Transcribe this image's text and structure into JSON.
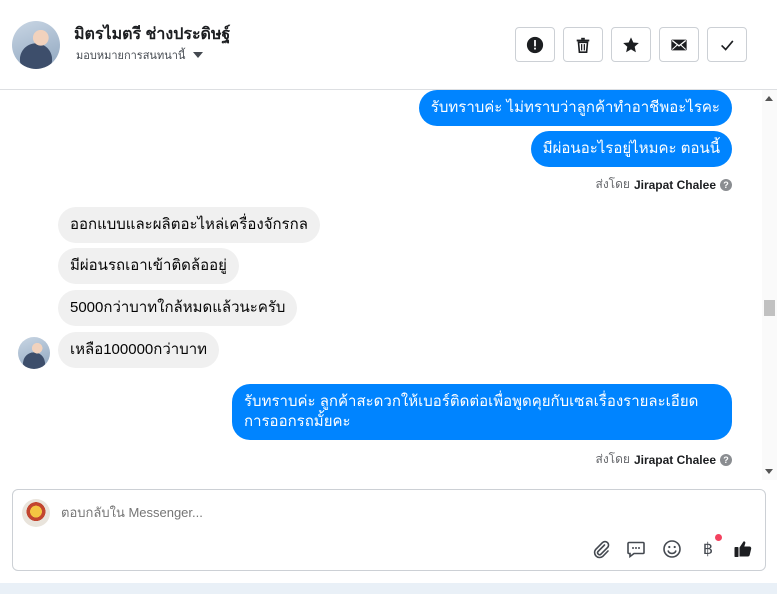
{
  "header": {
    "name": "มิตรไมตรี ช่างประดิษฐ์",
    "assign_label": "มอบหมายการสนทนานี้"
  },
  "toolbar": {
    "report": "report-icon",
    "delete": "trash-icon",
    "star": "star-icon",
    "mail": "envelope-icon",
    "done": "check-icon"
  },
  "messages": {
    "out1": "รับทราบค่ะ ไม่ทราบว่าลูกค้าทำอาชีพอะไรคะ",
    "out2": "มีผ่อนอะไรอยู่ไหมคะ ตอนนี้",
    "sent1_prefix": "ส่งโดย",
    "sent1_name": "Jirapat Chalee",
    "in1": "ออกแบบและผลิตอะไหล่เครื่องจักรกล",
    "in2": "มีผ่อนรถเอาเข้าติดล้ออยู่",
    "in3": "5000กว่าบาทใกล้หมดแล้วนะครับ",
    "in4": "เหลือ100000กว่าบาท",
    "out3": "รับทราบค่ะ ลูกค้าสะดวกให้เบอร์ติดต่อเพื่อพูดคุยกับเซลเรื่องรายละเอียดการออกรถมั้ยคะ",
    "sent2_prefix": "ส่งโดย",
    "sent2_name": "Jirapat Chalee",
    "help_glyph": "?"
  },
  "composer": {
    "placeholder": "ตอบกลับใน Messenger...",
    "icons": [
      "paperclip-icon",
      "saved-reply-icon",
      "emoji-icon",
      "baht-icon",
      "thumbs-up-icon"
    ],
    "baht_glyph": "฿"
  },
  "colors": {
    "outgoing_bubble": "#0084ff",
    "incoming_bubble": "#f0f0f0"
  }
}
